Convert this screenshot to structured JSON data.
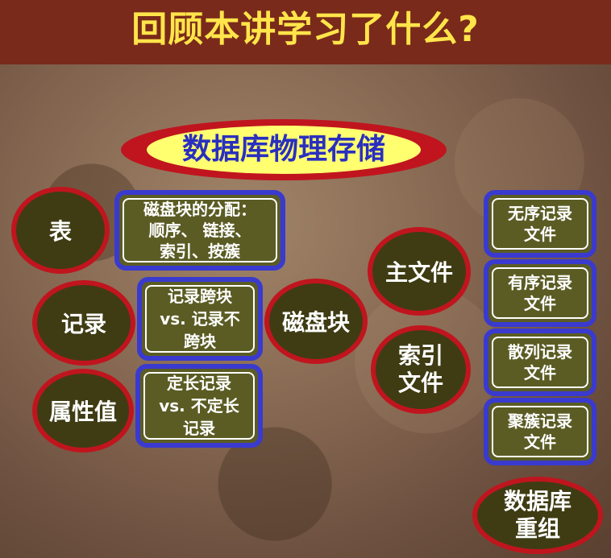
{
  "header": {
    "title": "回顾本讲学习了什么?"
  },
  "main": {
    "label": "数据库物理存储"
  },
  "nodes": {
    "table": "表",
    "record": "记录",
    "attribute": "属性值",
    "disk_block": "磁盘块",
    "main_file": "主文件",
    "index_file": "索引\n文件",
    "reorg": "数据库\n重组"
  },
  "boxes": {
    "block_alloc": "磁盘块的分配：\n顺序、 链接、\n索引、按簇",
    "span": "记录跨块\nvs. 记录不\n跨块",
    "fixed_len": "定长记录\nvs. 不定长\n记录",
    "unordered": "无序记录\n文件",
    "ordered": "有序记录\n文件",
    "hashed": "散列记录\n文件",
    "clustered": "聚簇记录\n文件"
  },
  "colors": {
    "header_bg": "#7a2a1a",
    "title_text": "#ffe54a",
    "oval_fill": "#3f3c14",
    "oval_border": "#c0151e",
    "box_fill": "#5b5c24",
    "box_border": "#3a3acf",
    "main_fill": "#ffff70",
    "main_text": "#2a2fbf"
  }
}
